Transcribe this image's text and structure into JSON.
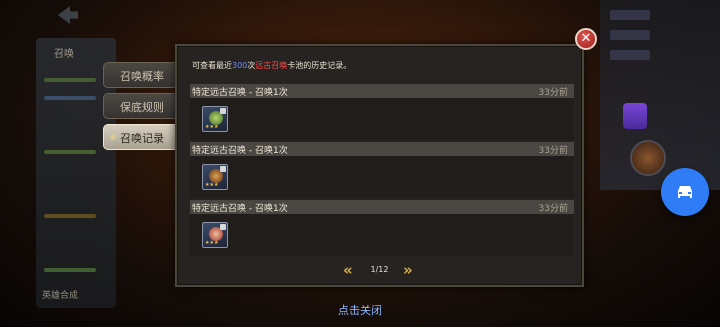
{
  "sidebar_bg": {
    "title": "召唤",
    "bottom_label": "英雄合成"
  },
  "tabs": [
    {
      "label": "召唤概率",
      "active": false
    },
    {
      "label": "保底规则",
      "active": false
    },
    {
      "label": "召唤记录",
      "active": true
    }
  ],
  "notice": {
    "prefix": "可查看最近",
    "count": "300",
    "mid": "次",
    "pool": "远古召唤",
    "suffix": "卡池的历史记录。"
  },
  "records": [
    {
      "title": "特定远古召唤 - 召唤1次",
      "time": "33分前",
      "card_icon": "hero-card-green-icon",
      "stars": "★★★"
    },
    {
      "title": "特定远古召唤 - 召唤1次",
      "time": "33分前",
      "card_icon": "hero-card-orange-icon",
      "stars": "★★★"
    },
    {
      "title": "特定远古召唤 - 召唤1次",
      "time": "33分前",
      "card_icon": "hero-card-red-icon",
      "stars": "★★★"
    }
  ],
  "pager": {
    "prev_icon": "double-chevron-left-icon",
    "next_icon": "double-chevron-right-icon",
    "page_label": "1/12"
  },
  "close_hint": "点击关闭",
  "colors": {
    "highlight_blue": "#6f8bff",
    "highlight_red": "#ff4b4b",
    "tab_active": "#d6cfbf",
    "float_button": "#2e7cf6"
  }
}
